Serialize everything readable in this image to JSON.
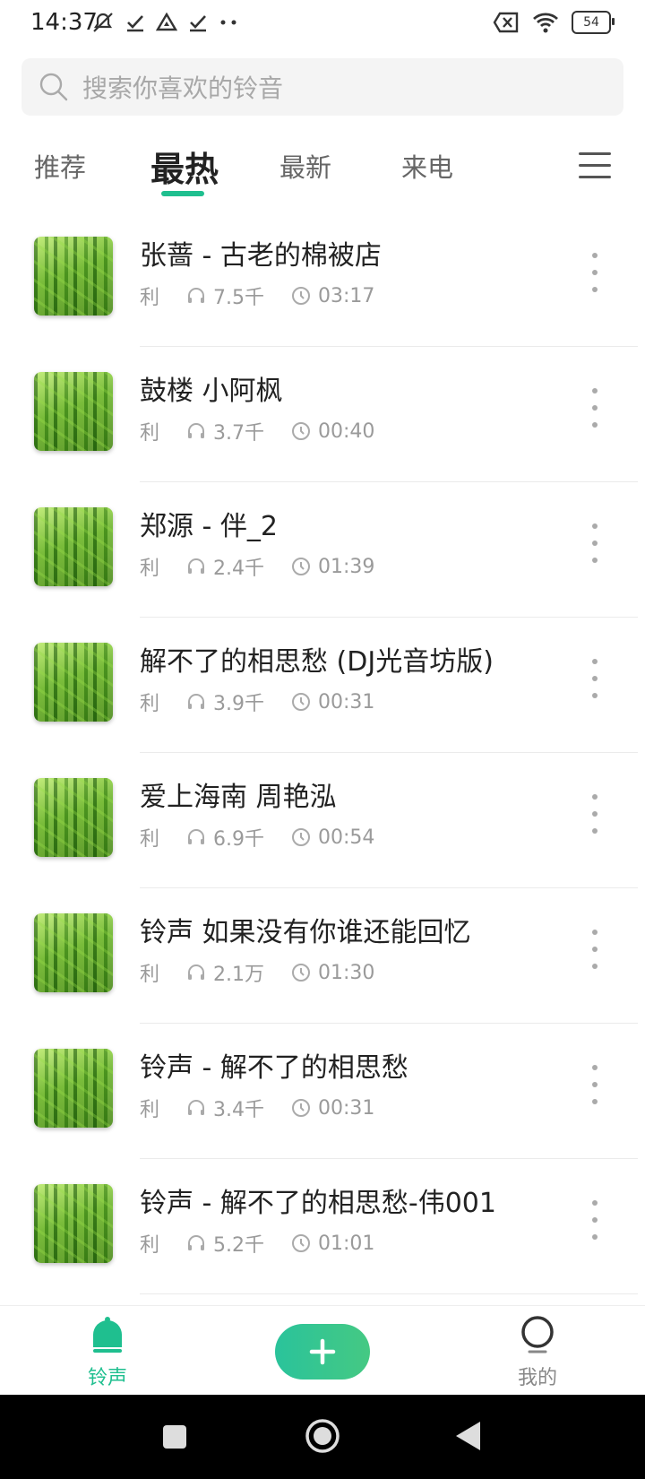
{
  "status_bar": {
    "time": "14:37",
    "battery": "54"
  },
  "search": {
    "placeholder": "搜索你喜欢的铃音"
  },
  "tabs": [
    {
      "label": "推荐"
    },
    {
      "label": "最热",
      "active": true
    },
    {
      "label": "最新"
    },
    {
      "label": "来电"
    }
  ],
  "ringtones": [
    {
      "title": "张蔷 - 古老的棉被店",
      "tag": "利",
      "plays": "7.5千",
      "duration": "03:17"
    },
    {
      "title": "鼓楼 小阿枫",
      "tag": "利",
      "plays": "3.7千",
      "duration": "00:40"
    },
    {
      "title": "郑源 - 伴_2",
      "tag": "利",
      "plays": "2.4千",
      "duration": "01:39"
    },
    {
      "title": "解不了的相思愁 (DJ光音坊版)",
      "tag": "利",
      "plays": "3.9千",
      "duration": "00:31"
    },
    {
      "title": "爱上海南 周艳泓",
      "tag": "利",
      "plays": "6.9千",
      "duration": "00:54"
    },
    {
      "title": "铃声 如果没有你谁还能回忆",
      "tag": "利",
      "plays": "2.1万",
      "duration": "01:30"
    },
    {
      "title": "铃声 - 解不了的相思愁",
      "tag": "利",
      "plays": "3.4千",
      "duration": "00:31"
    },
    {
      "title": "铃声 - 解不了的相思愁-伟001",
      "tag": "利",
      "plays": "5.2千",
      "duration": "01:01"
    }
  ],
  "bottom_nav": {
    "ringtone_label": "铃声",
    "mine_label": "我的"
  },
  "colors": {
    "accent": "#1fbf8f",
    "muted_text": "#9a9a9a"
  },
  "icons": [
    "search-icon",
    "menu-icon",
    "headphones-icon",
    "clock-icon",
    "more-vertical-icon",
    "bell-icon",
    "plus-icon",
    "user-icon"
  ]
}
